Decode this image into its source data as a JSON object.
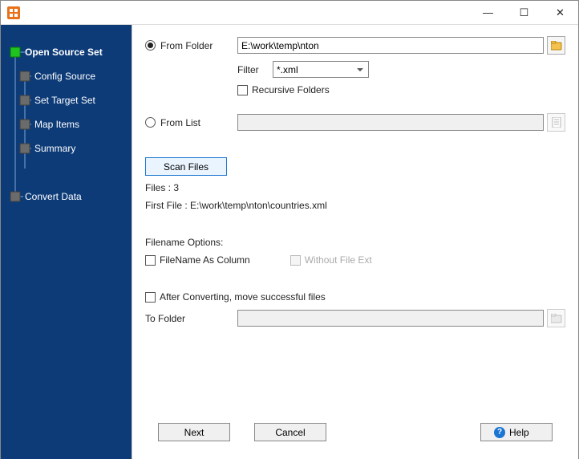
{
  "titlebar": {
    "min": "—",
    "max": "☐",
    "close": "✕"
  },
  "sidebar": {
    "items": [
      {
        "label": "Open Source Set"
      },
      {
        "label": "Config Source"
      },
      {
        "label": "Set Target Set"
      },
      {
        "label": "Map Items"
      },
      {
        "label": "Summary"
      },
      {
        "label": "Convert Data"
      }
    ]
  },
  "source": {
    "from_folder_label": "From Folder",
    "folder_path": "E:\\work\\temp\\nton",
    "filter_label": "Filter",
    "filter_value": "*.xml",
    "recursive_label": "Recursive Folders",
    "from_list_label": "From List",
    "from_list_value": ""
  },
  "scan": {
    "button": "Scan Files",
    "files_label": "Files : 3",
    "first_file_label": "First File : E:\\work\\temp\\nton\\countries.xml"
  },
  "filename_opts": {
    "heading": "Filename Options:",
    "as_column": "FileName As Column",
    "without_ext": "Without File Ext"
  },
  "after": {
    "label": "After Converting, move successful files",
    "to_folder_label": "To Folder",
    "to_folder_value": ""
  },
  "footer": {
    "next": "Next",
    "cancel": "Cancel",
    "help": "Help"
  }
}
